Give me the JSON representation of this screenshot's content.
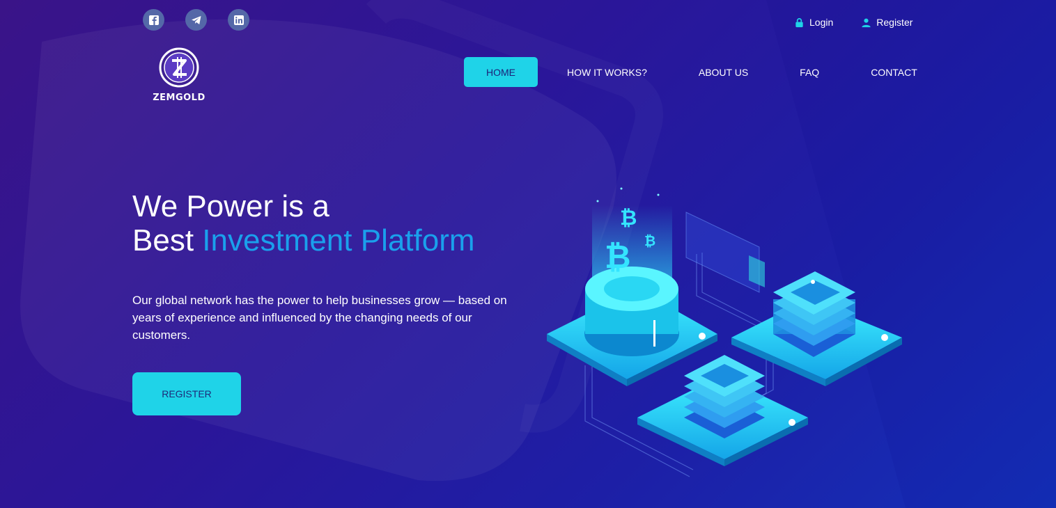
{
  "social": [
    {
      "name": "facebook-icon",
      "glyph": "f"
    },
    {
      "name": "telegram-icon",
      "glyph": "telegram"
    },
    {
      "name": "linkedin-icon",
      "glyph": "in"
    }
  ],
  "auth": {
    "login_label": "Login",
    "register_label": "Register"
  },
  "logo": {
    "text": "ZEMGOLD"
  },
  "nav": {
    "items": [
      {
        "label": "HOME",
        "active": true
      },
      {
        "label": "HOW IT WORKS?",
        "active": false
      },
      {
        "label": "ABOUT US",
        "active": false
      },
      {
        "label": "FAQ",
        "active": false
      },
      {
        "label": "CONTACT",
        "active": false
      }
    ]
  },
  "hero": {
    "title_line1": "We Power is a",
    "title_line2_plain": "Best ",
    "title_line2_accent": "Investment Platform",
    "description": "Our global network has the power to help businesses grow — based on years of experience and influenced by the changing needs of our customers.",
    "cta_label": "REGISTER"
  },
  "colors": {
    "accent": "#1fd3e8",
    "highlight_text": "#1aa0ec",
    "background_start": "#3a1488",
    "background_end": "#1430b8"
  }
}
